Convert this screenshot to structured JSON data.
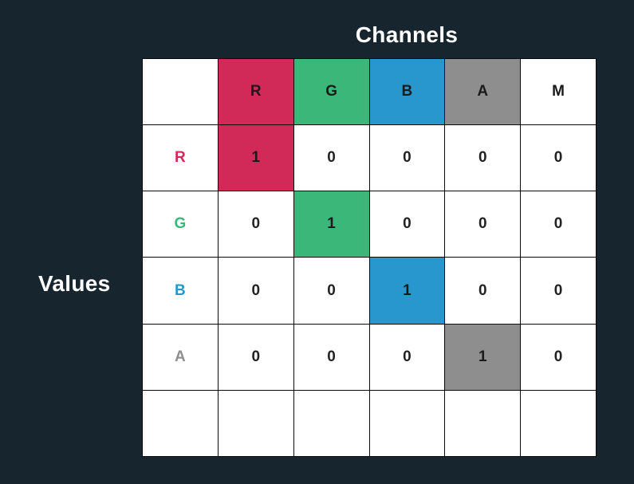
{
  "titles": {
    "channels": "Channels",
    "values": "Values"
  },
  "colors": {
    "R": "#d12a59",
    "G": "#3bb879",
    "B": "#2797cd",
    "A": "#8e8e8e",
    "M": "#ffffff"
  },
  "channels": [
    "R",
    "G",
    "B",
    "A",
    "M"
  ],
  "rows": [
    "R",
    "G",
    "B",
    "A"
  ],
  "matrix": {
    "R": {
      "R": "1",
      "G": "0",
      "B": "0",
      "A": "0",
      "M": "0"
    },
    "G": {
      "R": "0",
      "G": "1",
      "B": "0",
      "A": "0",
      "M": "0"
    },
    "B": {
      "R": "0",
      "G": "0",
      "B": "1",
      "A": "0",
      "M": "0"
    },
    "A": {
      "R": "0",
      "G": "0",
      "B": "0",
      "A": "1",
      "M": "0"
    }
  }
}
